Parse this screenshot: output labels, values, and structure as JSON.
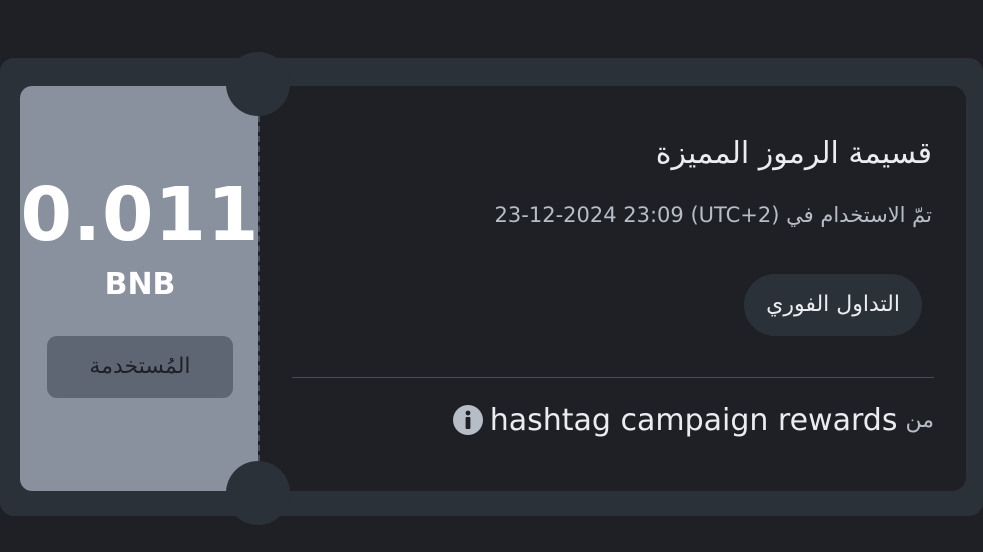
{
  "voucher": {
    "amount": "0.011",
    "unit": "BNB",
    "status_label": "المُستخدمة",
    "title": "قسيمة الرموز المميزة",
    "used_prefix": "تمّ الاستخدام في",
    "used_datetime": "23-12-2024 23:09 (UTC+2)",
    "action_label": "التداول الفوري",
    "source_prefix": "من",
    "source_name": "hashtag campaign rewards",
    "info_icon": "info-icon"
  },
  "colors": {
    "page_bg": "#1e2026",
    "card_bg": "#2b3139",
    "stub_bg": "#8a919e",
    "badge_bg": "#5e6673",
    "text_primary": "#eaecef",
    "text_secondary": "#b7bdc6"
  }
}
